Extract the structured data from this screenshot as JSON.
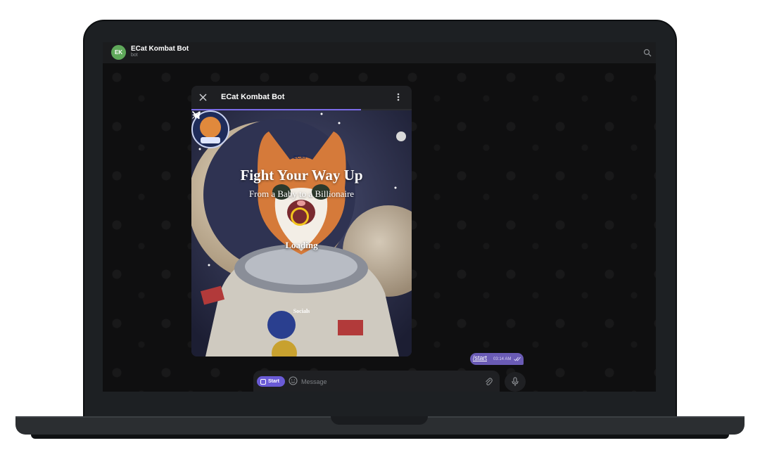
{
  "chat": {
    "avatar_initials": "EK",
    "title": "ECat Kombat Bot",
    "subtitle": "bot"
  },
  "miniapp": {
    "title": "ECat Kombat Bot",
    "progress": 0.77,
    "logo_text": "ECAT",
    "hero_title": "Fight Your Way Up",
    "hero_subtitle": "From a Baby to a Billionaire",
    "loading_text": "Loading",
    "socials_label": "Socials"
  },
  "message": {
    "text": "/start",
    "time": "03:14 AM"
  },
  "input": {
    "start_label": "Start",
    "placeholder": "Message"
  },
  "icons": {
    "search": "search-icon",
    "close": "close-icon",
    "more": "more-vertical-icon",
    "telegram": "telegram-icon",
    "x": "x-logo-icon",
    "emoji": "emoji-icon",
    "attach": "paperclip-icon",
    "mic": "microphone-icon",
    "read": "double-check-icon"
  },
  "colors": {
    "accent": "#6a5bd6",
    "bubble": "#6a5bb5",
    "spinner": "#f2c51e",
    "avatar": "#5fa85a"
  }
}
